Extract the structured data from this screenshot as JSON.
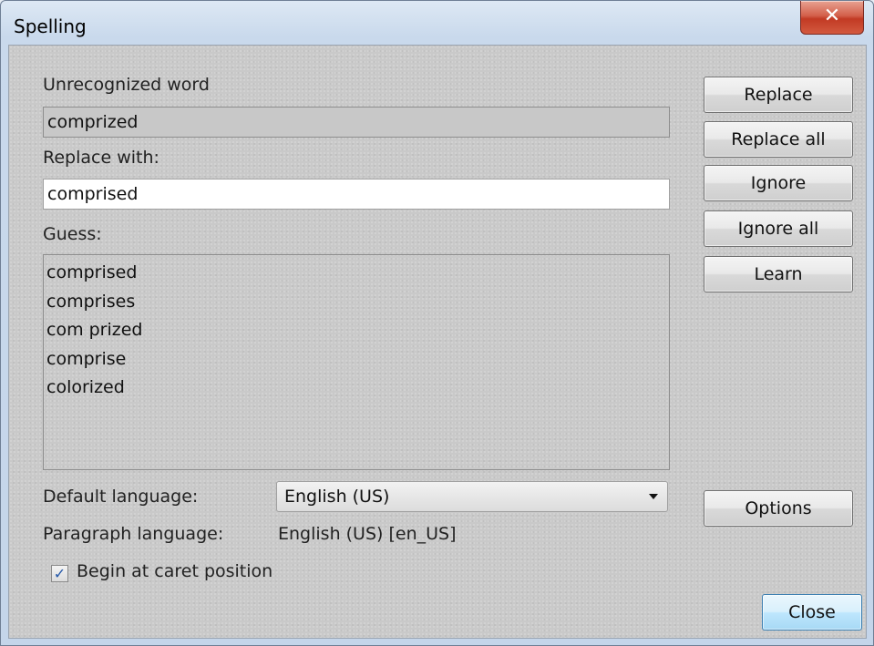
{
  "window": {
    "title": "Spelling",
    "close_glyph": "✕"
  },
  "labels": {
    "unrecognized_word": "Unrecognized word",
    "replace_with": "Replace with:",
    "guess": "Guess:",
    "default_language": "Default language:",
    "paragraph_language": "Paragraph language:",
    "paragraph_language_value": "English (US) [en_US]"
  },
  "fields": {
    "unrecognized_value": "comprized",
    "replace_with_value": "comprised"
  },
  "guesses": [
    "comprised",
    "comprises",
    "com prized",
    "comprise",
    "colorized"
  ],
  "language_select": {
    "selected": "English (US)"
  },
  "checkbox": {
    "label": "Begin at caret position",
    "checked": true,
    "check_glyph": "✓"
  },
  "buttons": {
    "replace": "Replace",
    "replace_all": "Replace all",
    "ignore": "Ignore",
    "ignore_all": "Ignore all",
    "learn": "Learn",
    "options": "Options",
    "close": "Close"
  },
  "icons": {
    "close": "close-icon",
    "dropdown": "chevron-down-icon",
    "check": "checkmark-icon"
  }
}
